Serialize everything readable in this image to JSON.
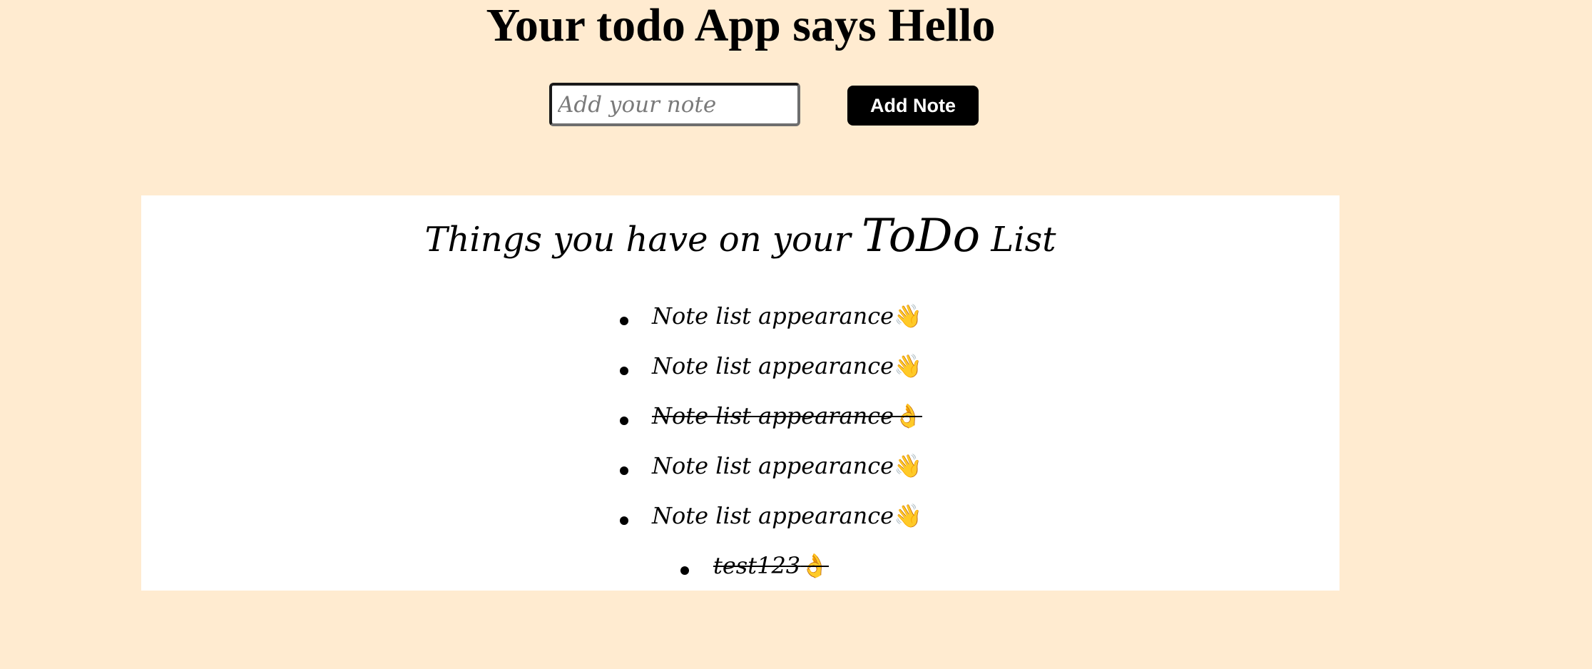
{
  "header": {
    "title": "Your todo App says Hello"
  },
  "form": {
    "note_placeholder": "Add your note",
    "note_value": "",
    "add_button_label": "Add Note"
  },
  "panel": {
    "heading_prefix": "Things you have on your ",
    "heading_emphasis": "ToDo",
    "heading_suffix": " List"
  },
  "todos": [
    {
      "text": "Note list appearance",
      "emoji": "👋",
      "done": false
    },
    {
      "text": "Note list appearance",
      "emoji": "👋",
      "done": false
    },
    {
      "text": "Note list appearance",
      "emoji": "👌",
      "done": true
    },
    {
      "text": "Note list appearance",
      "emoji": "👋",
      "done": false
    },
    {
      "text": "Note list appearance",
      "emoji": "👋",
      "done": false
    },
    {
      "text": "test123",
      "emoji": "👌",
      "done": true
    }
  ],
  "colors": {
    "page_background": "#FFEBD0",
    "panel_background": "#FFFFFF",
    "button_background": "#000000",
    "button_text": "#FFFFFF"
  }
}
